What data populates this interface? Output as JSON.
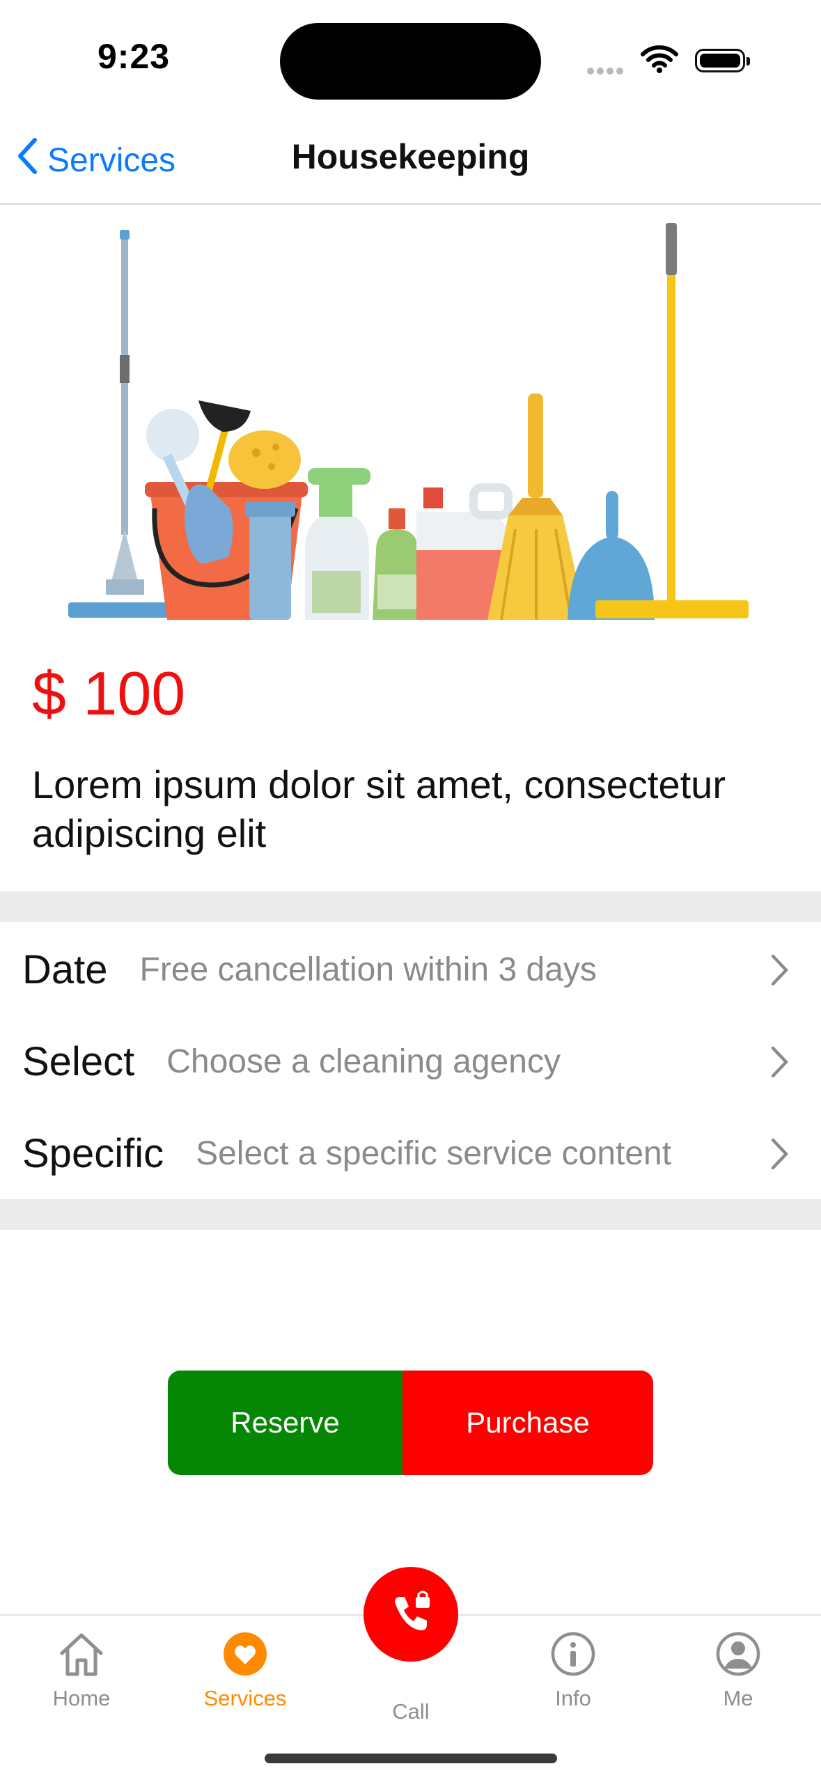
{
  "status_bar": {
    "time": "9:23"
  },
  "nav": {
    "back_label": "Services",
    "title": "Housekeeping"
  },
  "product": {
    "price": "$ 100",
    "description": "Lorem ipsum dolor sit amet, consectetur adipiscing elit"
  },
  "options": [
    {
      "label": "Date",
      "value": "Free cancellation within 3 days"
    },
    {
      "label": "Select",
      "value": "Choose a cleaning agency"
    },
    {
      "label": "Specific",
      "value": "Select a specific service content"
    }
  ],
  "actions": {
    "reserve_label": "Reserve",
    "purchase_label": "Purchase"
  },
  "tab_bar": {
    "active_color": "#ff8a00",
    "items": [
      {
        "label": "Home",
        "icon": "house-icon"
      },
      {
        "label": "Services",
        "icon": "heart-circle-icon"
      },
      {
        "label": "Call",
        "icon": "phone-lock-icon"
      },
      {
        "label": "Info",
        "icon": "info-circle-icon"
      },
      {
        "label": "Me",
        "icon": "person-circle-icon"
      }
    ]
  }
}
